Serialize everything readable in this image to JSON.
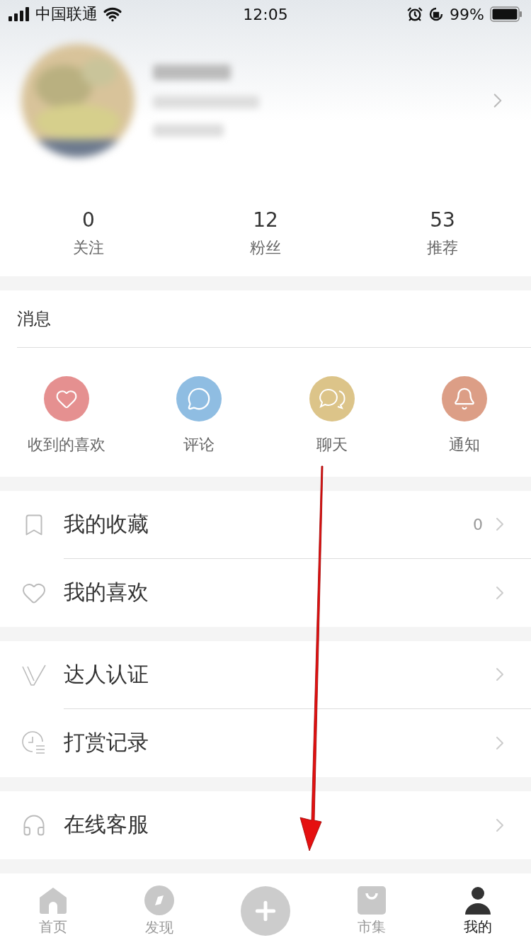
{
  "status_bar": {
    "carrier": "中国联通",
    "time": "12:05",
    "battery": "99%"
  },
  "stats": [
    {
      "value": "0",
      "label": "关注"
    },
    {
      "value": "12",
      "label": "粉丝"
    },
    {
      "value": "53",
      "label": "推荐"
    }
  ],
  "messages": {
    "title": "消息",
    "items": [
      {
        "kind": "heart",
        "label": "收到的喜欢",
        "color": "#e59090"
      },
      {
        "kind": "comment",
        "label": "评论",
        "color": "#8fbde2"
      },
      {
        "kind": "chat",
        "label": "聊天",
        "color": "#dcc489"
      },
      {
        "kind": "bell",
        "label": "通知",
        "color": "#dc9e86"
      }
    ]
  },
  "menu_groups": [
    [
      {
        "kind": "bookmark",
        "label": "我的收藏",
        "count": "0"
      },
      {
        "kind": "heart",
        "label": "我的喜欢"
      }
    ],
    [
      {
        "kind": "verified",
        "label": "达人认证"
      },
      {
        "kind": "clock",
        "label": "打赏记录"
      }
    ],
    [
      {
        "kind": "headset",
        "label": "在线客服"
      }
    ]
  ],
  "tab_bar": [
    {
      "kind": "home",
      "label": "首页",
      "selected": false
    },
    {
      "kind": "discover",
      "label": "发现",
      "selected": false
    },
    {
      "kind": "plus",
      "selected": false
    },
    {
      "kind": "market",
      "label": "市集",
      "selected": false
    },
    {
      "kind": "me",
      "label": "我的",
      "selected": true
    }
  ]
}
